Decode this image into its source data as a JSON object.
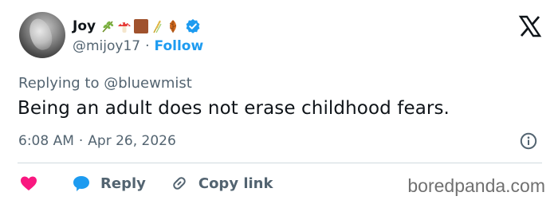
{
  "author": {
    "display_name": "Joy",
    "handle": "@mijoy17",
    "separator": "·",
    "follow_label": "Follow",
    "name_emojis": [
      "sprig-emoji",
      "mushroom-emoji",
      "brown-square-emoji",
      "wheat-emoji",
      "leaf-emoji"
    ],
    "verified": true
  },
  "platform_icon": "x-logo-icon",
  "tweet": {
    "replying_to": "Replying to @bluewmist",
    "text": "Being an adult does not erase childhood fears.",
    "time": "6:08 AM",
    "separator": "·",
    "date": "Apr 26, 2026"
  },
  "actions": {
    "reply_label": "Reply",
    "copy_link_label": "Copy link"
  },
  "watermark": "boredpanda.com",
  "colors": {
    "accent": "#1d9bf0",
    "heart": "#f91880",
    "text": "#0f1419",
    "muted": "#536471"
  }
}
